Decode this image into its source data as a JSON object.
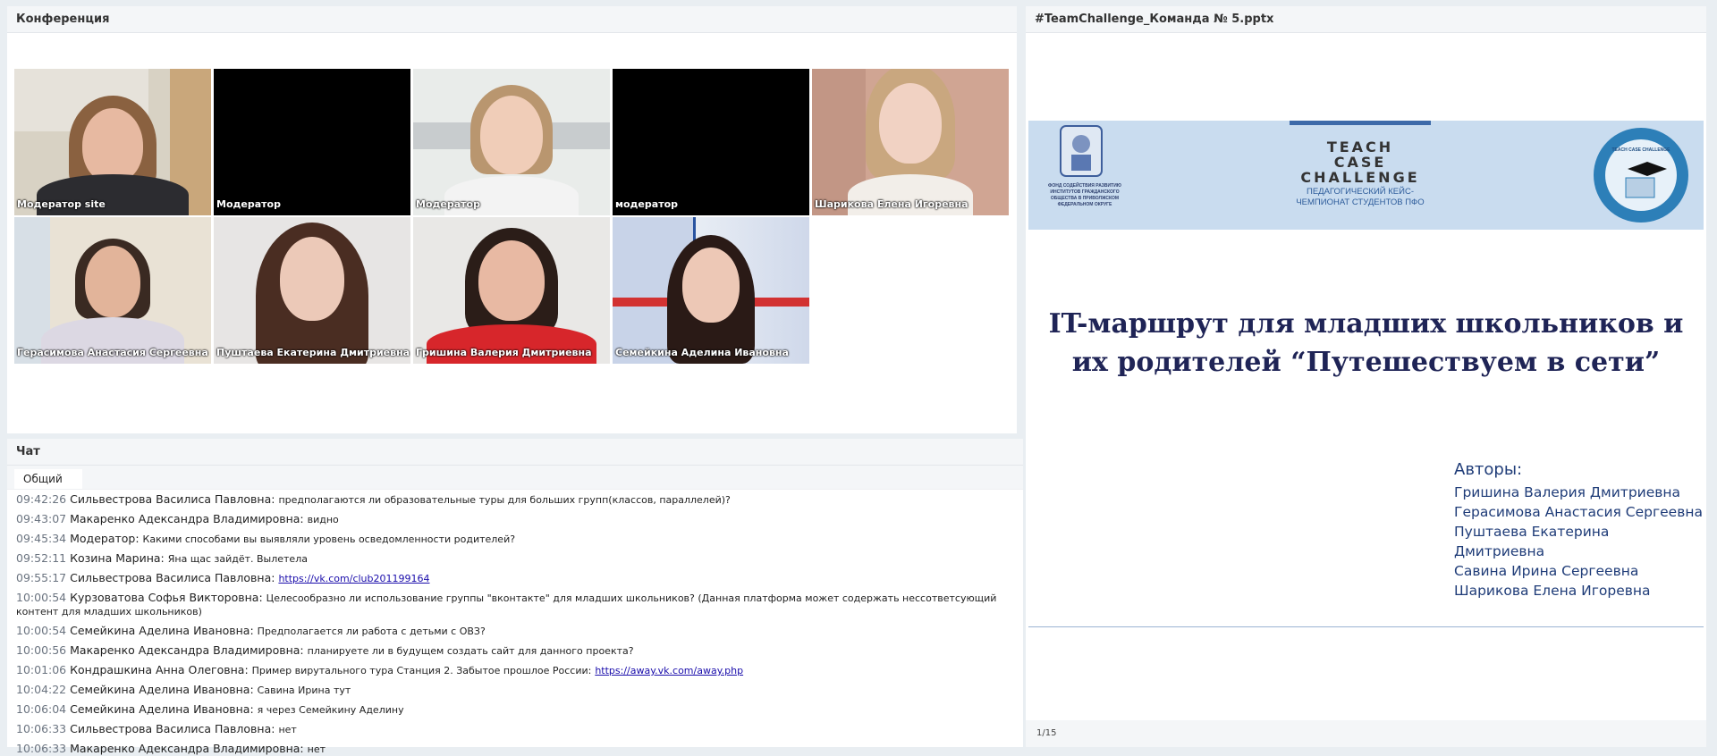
{
  "conference": {
    "title": "Конференция",
    "tiles": [
      {
        "name": "Модератор site"
      },
      {
        "name": "Модератор"
      },
      {
        "name": "Модератор"
      },
      {
        "name": "модератор"
      },
      {
        "name": "Шарикова Елена  Игоревна"
      },
      {
        "name": "Герасимова Анастасия   Сергеевна"
      },
      {
        "name": "Пуштаева Екатерина  Дмитриевна"
      },
      {
        "name": "Гришина Валерия  Дмитриевна"
      },
      {
        "name": "Семейкина Аделина Ивановна"
      }
    ]
  },
  "presentation": {
    "title": "#TeamChallenge_Команда № 5.pptx",
    "banner": {
      "left_logo_text": "ФОНД СОДЕЙСТВИЯ РАЗВИТИЮ ИНСТИТУТОВ ГРАЖДАНСКОГО ОБЩЕСТВА В ПРИВОЛЖСКОМ ФЕДЕРАЛЬНОМ ОКРУГЕ",
      "center_line1": "TEACH",
      "center_line2": "CASE",
      "center_line3": "CHALLENGE",
      "center_sub1": "ПЕДАГОГИЧЕСКИЙ КЕЙС-",
      "center_sub2": "ЧЕМПИОНАТ СТУДЕНТОВ ПФО",
      "right_logo_text": "TEACH CASE CHALLENGE"
    },
    "slide_title_line1": "IT-маршрут для младших школьников и",
    "slide_title_line2": "их родителей “Путешествуем в сети”",
    "authors_label": "Авторы:",
    "authors": [
      "Гришина  Валерия Дмитриевна",
      "Герасимова Анастасия Сергеевна",
      "Пуштаева Екатерина Дмитриевна",
      "Савина Ирина Сергеевна",
      "Шарикова Елена Игоревна"
    ],
    "page": "1/15"
  },
  "chat": {
    "title": "Чат",
    "tab": "Общий",
    "messages": [
      {
        "time": "09:42:26",
        "author": "Сильвестрова Василиса  Павловна:",
        "text": "предполагаются ли образовательные туры для больших групп(классов, параллелей)?"
      },
      {
        "time": "09:43:07",
        "author": "Макаренко Адександра  Владимировна:",
        "text": "видно"
      },
      {
        "time": "09:45:34",
        "author": "Модератор:",
        "text": "Какими способами вы выявляли уровень осведомленности родителей?"
      },
      {
        "time": "09:52:11",
        "author": "Козина Марина:",
        "text": "Яна щас зайдёт. Вылетела"
      },
      {
        "time": "09:55:17",
        "author": "Сильвестрова Василиса  Павловна:",
        "link": "https://vk.com/club201199164"
      },
      {
        "time": "10:00:54",
        "author": "Курзоватова  Софья   Викторовна:",
        "text": "Целесообразно ли использование группы  \"вконтакте\" для младших школьников? (Данная платформа может содержать нессответсующий контент для младших школьников)"
      },
      {
        "time": "10:00:54",
        "author": "Семейкина Аделина Ивановна:",
        "text": "Предполагается ли работа с детьми с ОВЗ?"
      },
      {
        "time": "10:00:56",
        "author": "Макаренко Адександра  Владимировна:",
        "text": "планируете ли в будущем создать сайт для данного проекта?"
      },
      {
        "time": "10:01:06",
        "author": "Кондрашкина Анна  Олеговна:",
        "text": "Пример вирутального тура Станция 2. Забытое прошлое России:",
        "link": "https://away.vk.com/away.php"
      },
      {
        "time": "10:04:22",
        "author": "Семейкина Аделина Ивановна:",
        "text": "Савина Ирина тут"
      },
      {
        "time": "10:06:04",
        "author": "Семейкина Аделина Ивановна:",
        "text": "я через Семейкину Аделину"
      },
      {
        "time": "10:06:33",
        "author": "Сильвестрова Василиса  Павловна:",
        "text": "нет"
      },
      {
        "time": "10:06:33",
        "author": "Макаренко Адександра  Владимировна:",
        "text": "нет"
      }
    ]
  }
}
